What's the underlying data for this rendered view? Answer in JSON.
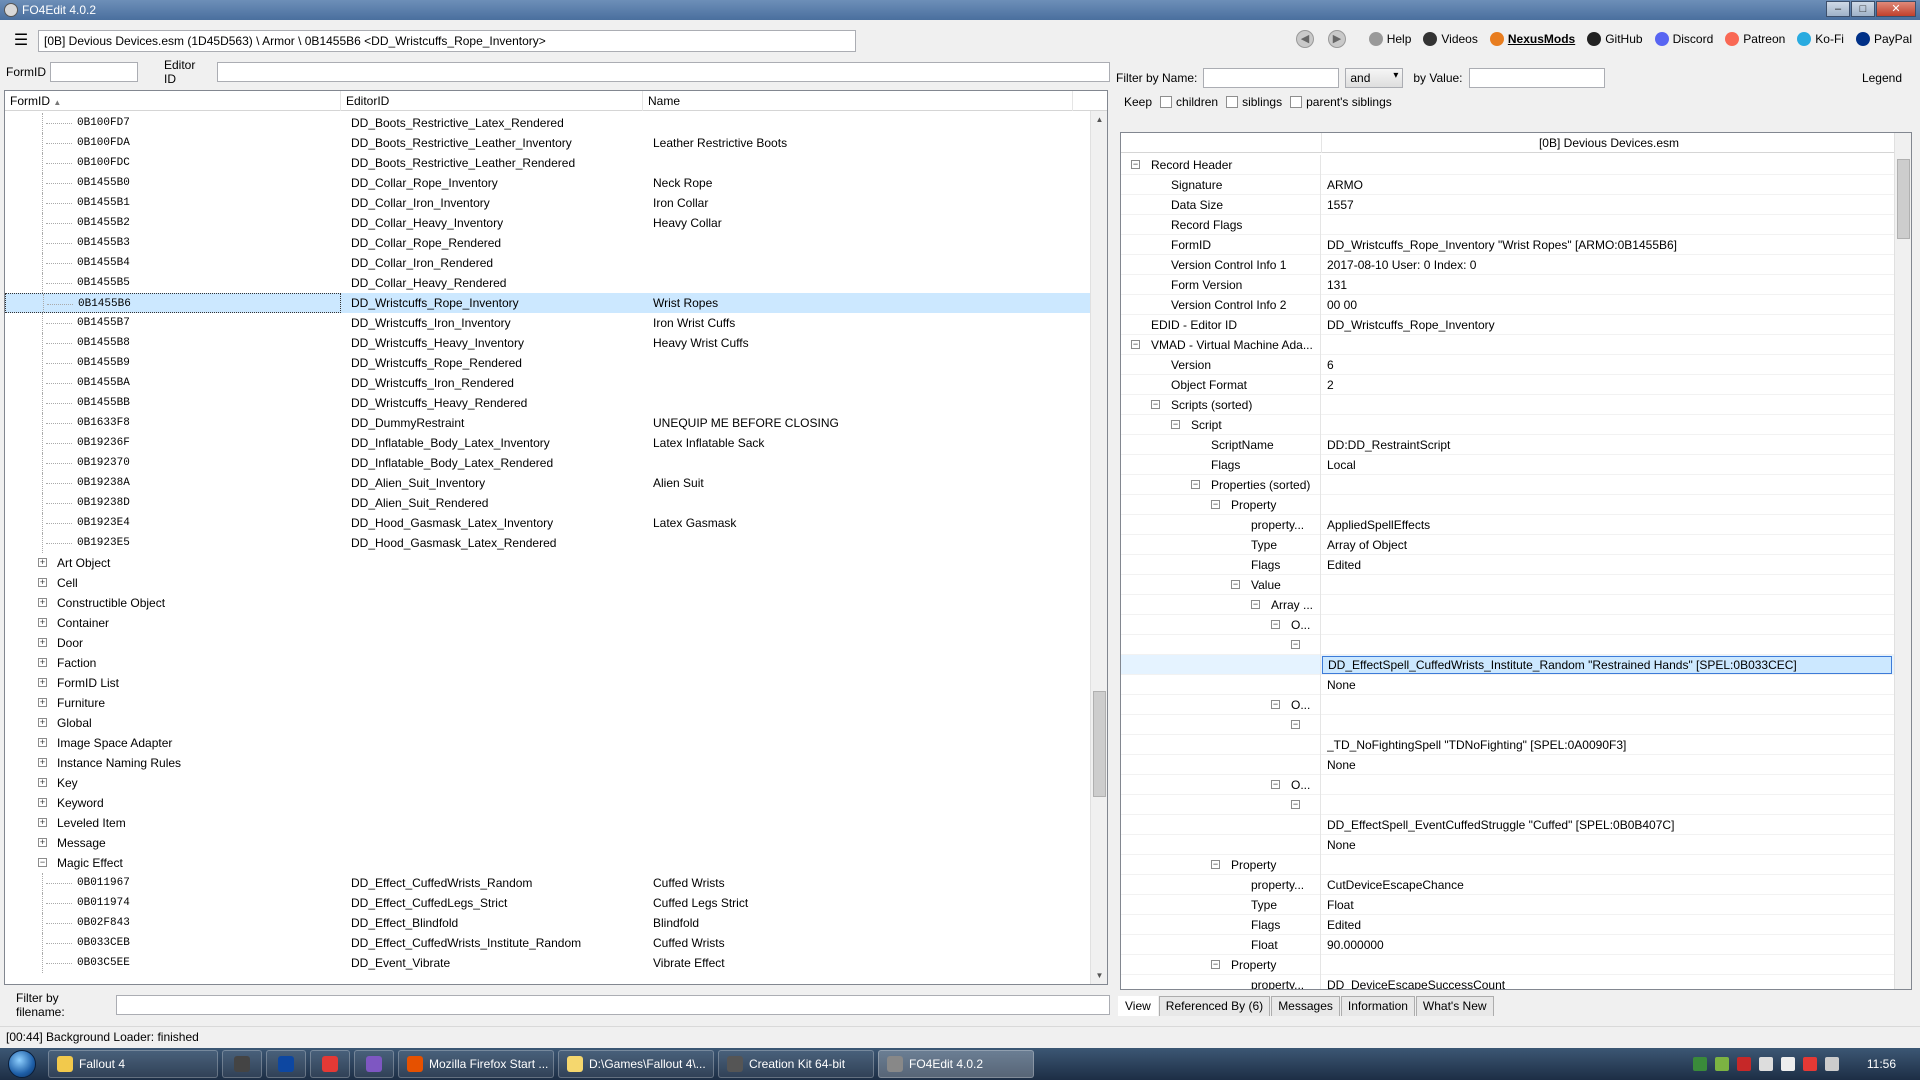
{
  "window": {
    "title": "FO4Edit 4.0.2"
  },
  "toolbar": {
    "path": "[0B] Devious Devices.esm (1D45D563) \\ Armor \\ 0B1455B6 <DD_Wristcuffs_Rope_Inventory>",
    "links": [
      "Help",
      "Videos",
      "NexusMods",
      "GitHub",
      "Discord",
      "Patreon",
      "Ko-Fi",
      "PayPal"
    ]
  },
  "left_filter": {
    "formid_label": "FormID",
    "editorid_label": "Editor ID"
  },
  "left_tree": {
    "headers": [
      "FormID",
      "EditorID",
      "Name"
    ],
    "rows": [
      {
        "type": "rec",
        "id": "0B100FD7",
        "edid": "DD_Boots_Restrictive_Latex_Rendered",
        "name": ""
      },
      {
        "type": "rec",
        "id": "0B100FDA",
        "edid": "DD_Boots_Restrictive_Leather_Inventory",
        "name": "Leather Restrictive Boots"
      },
      {
        "type": "rec",
        "id": "0B100FDC",
        "edid": "DD_Boots_Restrictive_Leather_Rendered",
        "name": ""
      },
      {
        "type": "rec",
        "id": "0B1455B0",
        "edid": "DD_Collar_Rope_Inventory",
        "name": "Neck Rope"
      },
      {
        "type": "rec",
        "id": "0B1455B1",
        "edid": "DD_Collar_Iron_Inventory",
        "name": "Iron Collar"
      },
      {
        "type": "rec",
        "id": "0B1455B2",
        "edid": "DD_Collar_Heavy_Inventory",
        "name": "Heavy Collar"
      },
      {
        "type": "rec",
        "id": "0B1455B3",
        "edid": "DD_Collar_Rope_Rendered",
        "name": ""
      },
      {
        "type": "rec",
        "id": "0B1455B4",
        "edid": "DD_Collar_Iron_Rendered",
        "name": ""
      },
      {
        "type": "rec",
        "id": "0B1455B5",
        "edid": "DD_Collar_Heavy_Rendered",
        "name": ""
      },
      {
        "type": "rec",
        "id": "0B1455B6",
        "edid": "DD_Wristcuffs_Rope_Inventory",
        "name": "Wrist Ropes",
        "selected": true
      },
      {
        "type": "rec",
        "id": "0B1455B7",
        "edid": "DD_Wristcuffs_Iron_Inventory",
        "name": "Iron Wrist Cuffs"
      },
      {
        "type": "rec",
        "id": "0B1455B8",
        "edid": "DD_Wristcuffs_Heavy_Inventory",
        "name": "Heavy Wrist Cuffs"
      },
      {
        "type": "rec",
        "id": "0B1455B9",
        "edid": "DD_Wristcuffs_Rope_Rendered",
        "name": ""
      },
      {
        "type": "rec",
        "id": "0B1455BA",
        "edid": "DD_Wristcuffs_Iron_Rendered",
        "name": ""
      },
      {
        "type": "rec",
        "id": "0B1455BB",
        "edid": "DD_Wristcuffs_Heavy_Rendered",
        "name": ""
      },
      {
        "type": "rec",
        "id": "0B1633F8",
        "edid": "DD_DummyRestraint",
        "name": " UNEQUIP ME BEFORE CLOSING"
      },
      {
        "type": "rec",
        "id": "0B19236F",
        "edid": "DD_Inflatable_Body_Latex_Inventory",
        "name": "Latex Inflatable Sack"
      },
      {
        "type": "rec",
        "id": "0B192370",
        "edid": "DD_Inflatable_Body_Latex_Rendered",
        "name": ""
      },
      {
        "type": "rec",
        "id": "0B19238A",
        "edid": "DD_Alien_Suit_Inventory",
        "name": "Alien Suit"
      },
      {
        "type": "rec",
        "id": "0B19238D",
        "edid": "DD_Alien_Suit_Rendered",
        "name": ""
      },
      {
        "type": "rec",
        "id": "0B1923E4",
        "edid": "DD_Hood_Gasmask_Latex_Inventory",
        "name": "Latex Gasmask"
      },
      {
        "type": "rec",
        "id": "0B1923E5",
        "edid": "DD_Hood_Gasmask_Latex_Rendered",
        "name": ""
      },
      {
        "type": "grp",
        "label": "Art Object",
        "open": false
      },
      {
        "type": "grp",
        "label": "Cell",
        "open": false
      },
      {
        "type": "grp",
        "label": "Constructible Object",
        "open": false
      },
      {
        "type": "grp",
        "label": "Container",
        "open": false
      },
      {
        "type": "grp",
        "label": "Door",
        "open": false
      },
      {
        "type": "grp",
        "label": "Faction",
        "open": false
      },
      {
        "type": "grp",
        "label": "FormID List",
        "open": false
      },
      {
        "type": "grp",
        "label": "Furniture",
        "open": false
      },
      {
        "type": "grp",
        "label": "Global",
        "open": false
      },
      {
        "type": "grp",
        "label": "Image Space Adapter",
        "open": false
      },
      {
        "type": "grp",
        "label": "Instance Naming Rules",
        "open": false
      },
      {
        "type": "grp",
        "label": "Key",
        "open": false
      },
      {
        "type": "grp",
        "label": "Keyword",
        "open": false
      },
      {
        "type": "grp",
        "label": "Leveled Item",
        "open": false
      },
      {
        "type": "grp",
        "label": "Message",
        "open": false
      },
      {
        "type": "grp",
        "label": "Magic Effect",
        "open": true
      },
      {
        "type": "rec",
        "id": "0B011967",
        "edid": "DD_Effect_CuffedWrists_Random",
        "name": "Cuffed Wrists"
      },
      {
        "type": "rec",
        "id": "0B011974",
        "edid": "DD_Effect_CuffedLegs_Strict",
        "name": "Cuffed Legs Strict"
      },
      {
        "type": "rec",
        "id": "0B02F843",
        "edid": "DD_Effect_Blindfold",
        "name": "Blindfold"
      },
      {
        "type": "rec",
        "id": "0B033CEB",
        "edid": "DD_Effect_CuffedWrists_Institute_Random",
        "name": "Cuffed Wrists"
      },
      {
        "type": "rec",
        "id": "0B03C5EE",
        "edid": "DD_Event_Vibrate",
        "name": "Vibrate Effect"
      }
    ]
  },
  "filename_filter": {
    "label": "Filter by filename:"
  },
  "right_filter": {
    "name_label": "Filter by Name:",
    "op": "and",
    "value_label": "by Value:",
    "legend": "Legend",
    "keep_label": "Keep",
    "checks": [
      "children",
      "siblings",
      "parent's siblings"
    ]
  },
  "right_tree": {
    "header": "[0B] Devious Devices.esm",
    "rows": [
      {
        "d": 0,
        "exp": "-",
        "k": "Record Header",
        "v": ""
      },
      {
        "d": 1,
        "k": "Signature",
        "v": "ARMO"
      },
      {
        "d": 1,
        "k": "Data Size",
        "v": "1557"
      },
      {
        "d": 1,
        "k": "Record Flags",
        "v": ""
      },
      {
        "d": 1,
        "k": "FormID",
        "v": "DD_Wristcuffs_Rope_Inventory \"Wrist Ropes\" [ARMO:0B1455B6]"
      },
      {
        "d": 1,
        "k": "Version Control Info 1",
        "v": "2017-08-10 User: 0 Index: 0"
      },
      {
        "d": 1,
        "k": "Form Version",
        "v": "131"
      },
      {
        "d": 1,
        "k": "Version Control Info 2",
        "v": "00 00"
      },
      {
        "d": 0,
        "k": "EDID - Editor ID",
        "v": "DD_Wristcuffs_Rope_Inventory"
      },
      {
        "d": 0,
        "exp": "-",
        "k": "VMAD - Virtual Machine Ada...",
        "v": ""
      },
      {
        "d": 1,
        "k": "Version",
        "v": "6"
      },
      {
        "d": 1,
        "k": "Object Format",
        "v": "2"
      },
      {
        "d": 1,
        "exp": "-",
        "k": "Scripts (sorted)",
        "v": ""
      },
      {
        "d": 2,
        "exp": "-",
        "k": "Script",
        "v": ""
      },
      {
        "d": 3,
        "k": "ScriptName",
        "v": "DD:DD_RestraintScript"
      },
      {
        "d": 3,
        "k": "Flags",
        "v": "Local"
      },
      {
        "d": 3,
        "exp": "-",
        "k": "Properties (sorted)",
        "v": ""
      },
      {
        "d": 4,
        "exp": "-",
        "k": "Property",
        "v": ""
      },
      {
        "d": 5,
        "k": "property...",
        "v": "AppliedSpellEffects"
      },
      {
        "d": 5,
        "k": "Type",
        "v": "Array of Object"
      },
      {
        "d": 5,
        "k": "Flags",
        "v": "Edited"
      },
      {
        "d": 5,
        "exp": "-",
        "k": "Value",
        "v": ""
      },
      {
        "d": 6,
        "exp": "-",
        "k": "Array ...",
        "v": ""
      },
      {
        "d": 7,
        "exp": "-",
        "k": "O...",
        "v": ""
      },
      {
        "d": 8,
        "exp": "-",
        "k": "",
        "v": ""
      },
      {
        "d": 9,
        "k": "",
        "v": "DD_EffectSpell_CuffedWrists_Institute_Random \"Restrained Hands\" [SPEL:0B033CEC]",
        "selected": true
      },
      {
        "d": 9,
        "k": "",
        "v": "None"
      },
      {
        "d": 7,
        "exp": "-",
        "k": "O...",
        "v": ""
      },
      {
        "d": 8,
        "exp": "-",
        "k": "",
        "v": ""
      },
      {
        "d": 9,
        "k": "",
        "v": "_TD_NoFightingSpell \"TDNoFighting\" [SPEL:0A0090F3]"
      },
      {
        "d": 9,
        "k": "",
        "v": "None"
      },
      {
        "d": 7,
        "exp": "-",
        "k": "O...",
        "v": ""
      },
      {
        "d": 8,
        "exp": "-",
        "k": "",
        "v": ""
      },
      {
        "d": 9,
        "k": "",
        "v": "DD_EffectSpell_EventCuffedStruggle \"Cuffed\" [SPEL:0B0B407C]"
      },
      {
        "d": 9,
        "k": "",
        "v": "None"
      },
      {
        "d": 4,
        "exp": "-",
        "k": "Property",
        "v": ""
      },
      {
        "d": 5,
        "k": "property...",
        "v": "CutDeviceEscapeChance"
      },
      {
        "d": 5,
        "k": "Type",
        "v": "Float"
      },
      {
        "d": 5,
        "k": "Flags",
        "v": "Edited"
      },
      {
        "d": 5,
        "k": "Float",
        "v": "90.000000"
      },
      {
        "d": 4,
        "exp": "-",
        "k": "Property",
        "v": ""
      },
      {
        "d": 5,
        "k": "property...",
        "v": "DD_DeviceEscapeSuccessCount"
      }
    ]
  },
  "tabs": [
    "View",
    "Referenced By (6)",
    "Messages",
    "Information",
    "What's New"
  ],
  "status": "[00:44] Background Loader: finished",
  "taskbar": {
    "items": [
      "Fallout 4",
      "",
      "",
      "",
      "",
      "Mozilla Firefox Start ...",
      "D:\\Games\\Fallout 4\\...",
      "Creation Kit 64-bit",
      "FO4Edit 4.0.2"
    ],
    "clock": "11:56"
  }
}
